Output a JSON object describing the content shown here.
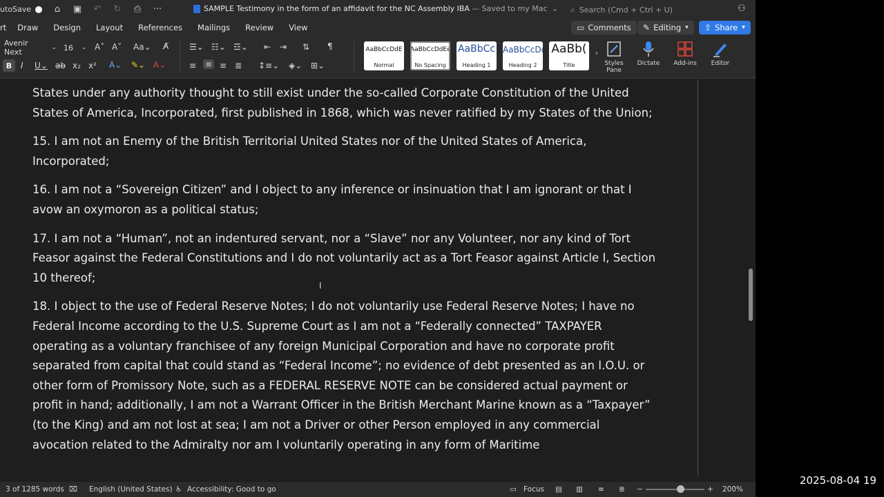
{
  "titlebar": {
    "autosave_label": "utoSave",
    "doc_title": "SAMPLE Testimony in the form of an affidavit for the NC Assembly IBA",
    "saved_status": "— Saved to my Mac",
    "search_placeholder": "Search (Cmd + Ctrl + U)"
  },
  "tabs": {
    "items": [
      "rt",
      "Draw",
      "Design",
      "Layout",
      "References",
      "Mailings",
      "Review",
      "View"
    ]
  },
  "actions": {
    "comments": "Comments",
    "editing": "Editing",
    "share": "Share"
  },
  "ribbon": {
    "font_name": "Avenir Next",
    "font_size": "16",
    "styles": [
      {
        "sample": "AaBbCcDdE",
        "label": "Normal"
      },
      {
        "sample": "AaBbCcDdEe",
        "label": "No Spacing"
      },
      {
        "sample": "AaBbCc",
        "label": "Heading 1"
      },
      {
        "sample": "AaBbCcDd",
        "label": "Heading 2"
      },
      {
        "sample": "AaBb(",
        "label": "Title"
      }
    ],
    "styles_pane": "Styles Pane",
    "dictate": "Dictate",
    "addins": "Add-ins",
    "editor": "Editor"
  },
  "document": {
    "paragraphs": [
      "States under any authority thought to still exist under the so-called Corporate Constitution of the United States of America, Incorporated, first published in 1868, which was never ratified by my States of the Union;",
      "15. I am not an Enemy of the British Territorial United States nor of the United States of America, Incorporated;",
      "16. I am not a “Sovereign Citizen” and I object to any inference or insinuation that I am ignorant or that I avow an oxymoron as a political status;",
      "17. I am not a “Human”, not an indentured servant, nor a “Slave” nor any Volunteer, nor any kind of Tort Feasor against the Federal Constitutions and I do not voluntarily act as a Tort Feasor against Article I, Section 10 thereof;",
      "18. I object to the use of Federal Reserve Notes; I do not voluntarily use Federal Reserve Notes; I have no Federal Income according to the U.S. Supreme Court as I am not a “Federally connected” TAXPAYER operating as a voluntary franchisee of any foreign Municipal Corporation and have no corporate profit separated from capital that could stand as “Federal Income”; no evidence of debt presented as an I.O.U. or other form of Promissory Note, such as a FEDERAL RESERVE NOTE can be considered actual payment or profit in hand; additionally, I am not a Warrant Officer in the British Merchant Marine known as a “Taxpayer” (to the King) and am not lost at sea; I am not a Driver or other Person employed in any commercial avocation related to the Admiralty nor am I voluntarily operating in any form of Maritime"
    ]
  },
  "status": {
    "word_count": "3 of 1285 words",
    "language": "English (United States)",
    "accessibility": "Accessibility: Good to go",
    "focus": "Focus",
    "zoom": "200%"
  },
  "overlay": {
    "timestamp": "2025-08-04  19"
  },
  "colors": {
    "accent": "#2f7ae5",
    "chrome": "#2b2b2b",
    "page": "#1e1e1e"
  }
}
